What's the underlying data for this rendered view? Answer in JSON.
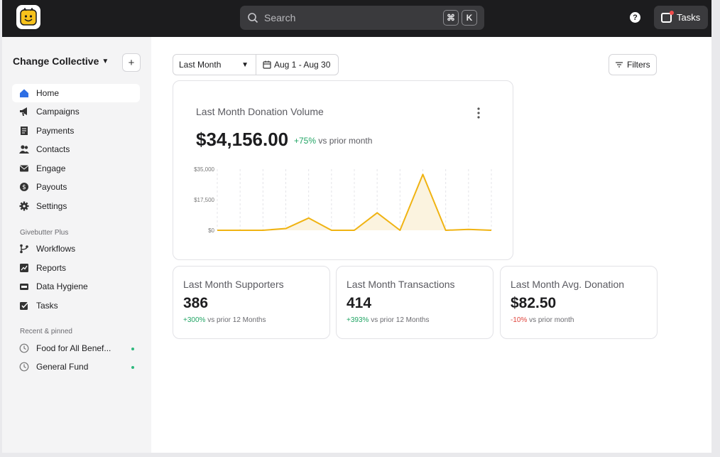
{
  "topbar": {
    "search_placeholder": "Search",
    "kbd_cmd": "⌘",
    "kbd_key": "K",
    "help_label": "?",
    "tasks_label": "Tasks"
  },
  "sidebar": {
    "org_name": "Change Collective",
    "add_label": "+",
    "items": [
      {
        "label": "Home",
        "icon": "home-icon"
      },
      {
        "label": "Campaigns",
        "icon": "megaphone-icon"
      },
      {
        "label": "Payments",
        "icon": "receipt-icon"
      },
      {
        "label": "Contacts",
        "icon": "people-icon"
      },
      {
        "label": "Engage",
        "icon": "mail-icon"
      },
      {
        "label": "Payouts",
        "icon": "dollar-icon"
      },
      {
        "label": "Settings",
        "icon": "gear-icon"
      }
    ],
    "plus_label": "Givebutter Plus",
    "plus_items": [
      {
        "label": "Workflows",
        "icon": "workflow-icon"
      },
      {
        "label": "Reports",
        "icon": "chart-icon"
      },
      {
        "label": "Data Hygiene",
        "icon": "broom-icon"
      },
      {
        "label": "Tasks",
        "icon": "checkbox-icon"
      }
    ],
    "recent_label": "Recent & pinned",
    "recent_items": [
      {
        "label": "Food for All Benef...",
        "icon": "clock-icon"
      },
      {
        "label": "General Fund",
        "icon": "clock-icon"
      }
    ]
  },
  "toolbar": {
    "period": "Last Month",
    "date_range": "Aug 1 - Aug 30",
    "filters_label": "Filters"
  },
  "donation_card": {
    "title": "Last Month Donation Volume",
    "value": "$34,156.00",
    "delta": "+75%",
    "delta_suffix": " vs prior month"
  },
  "stats": [
    {
      "title": "Last Month Supporters",
      "value": "386",
      "delta": "+300%",
      "delta_suffix": " vs prior 12 Months"
    },
    {
      "title": "Last Month Transactions",
      "value": "414",
      "delta": "+393%",
      "delta_suffix": " vs prior 12 Months"
    },
    {
      "title": "Last Month Avg. Donation",
      "value": "$82.50",
      "delta": "-10%",
      "delta_suffix": " vs prior month"
    }
  ],
  "colors": {
    "accent": "#f0b312",
    "positive": "#22a565",
    "negative": "#e0443c",
    "active_icon": "#2f6fe4"
  },
  "chart_data": {
    "type": "area",
    "y_ticks": [
      "$35,000",
      "$17,500",
      "$0"
    ],
    "ylim": [
      0,
      35000
    ],
    "x": [
      1,
      2,
      3,
      4,
      5,
      6,
      7,
      8,
      9,
      10,
      11,
      12
    ],
    "series": [
      {
        "values": [
          0,
          0,
          0,
          1000,
          7000,
          0,
          0,
          10000,
          0,
          32000,
          0,
          500,
          0
        ]
      }
    ],
    "grid": "vertical dashed"
  }
}
